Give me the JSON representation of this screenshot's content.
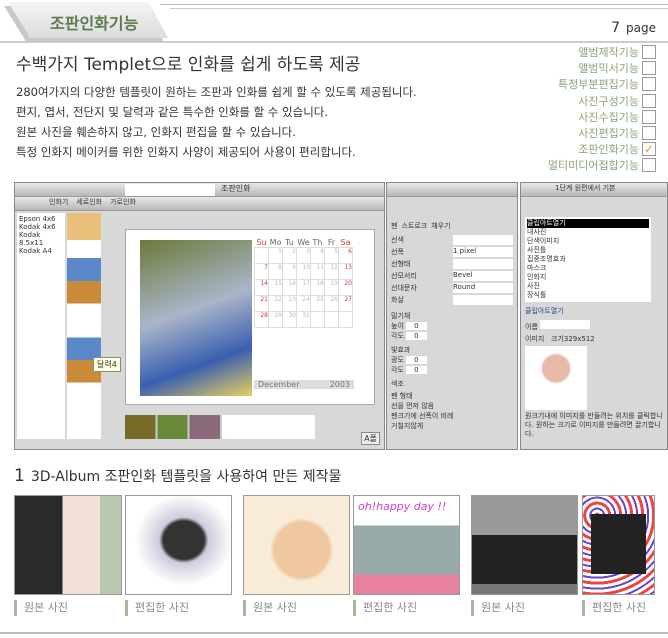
{
  "header": {
    "tab_title": "조판인화기능",
    "page_number": "7",
    "page_label": "page"
  },
  "main": {
    "title": "수백가지 Templet으로 인화를 쉽게 하도록 제공",
    "lines": [
      "280여가지의 다양한 템플릿이 원하는 조판과 인화를 쉽게 할 수 있도록 제공됩니다.",
      "편지, 엽서, 전단지 및 달력과 같은 특수한 인화를 할 수 있습니다.",
      "원본 사진을 훼손하지 않고, 인화지 편집을 할 수 있습니다.",
      "특정 인화지 메이커를 위한 인화지 사양이 제공되어 사용이 편리합니다."
    ]
  },
  "features": [
    {
      "label": "앨범제작기능",
      "checked": false
    },
    {
      "label": "앨범믹서기능",
      "checked": false
    },
    {
      "label": "특정부분편집기능",
      "checked": false
    },
    {
      "label": "사진구성기능",
      "checked": false
    },
    {
      "label": "사진수집기능",
      "checked": false
    },
    {
      "label": "사진편집기능",
      "checked": false
    },
    {
      "label": "조판인화기능",
      "checked": true,
      "mark": "✓"
    },
    {
      "label": "멀티미디어접합기능",
      "checked": false
    }
  ],
  "screenshot": {
    "tab": "조판인화",
    "toolbar": {
      "print": "인화기",
      "option": "세로인화",
      "option2": "가로인화"
    },
    "tree": [
      "Epson 4x6",
      "Kodak 4x6",
      "Kodak 8.5x11",
      "Kodak A4"
    ],
    "tooltip": "달력4",
    "calendar": {
      "days": [
        "Su",
        "Mo",
        "Tu",
        "We",
        "Th",
        "Fr",
        "Sa"
      ],
      "dates": [
        "",
        "1",
        "2",
        "3",
        "4",
        "5",
        "6",
        "7",
        "8",
        "9",
        "10",
        "11",
        "12",
        "13",
        "14",
        "15",
        "16",
        "17",
        "18",
        "19",
        "20",
        "21",
        "22",
        "23",
        "24",
        "25",
        "26",
        "27",
        "28",
        "29",
        "30",
        "31"
      ],
      "month": "December",
      "year": "2003"
    },
    "zoom_btn": "A폴",
    "pen_tabs": [
      "펜",
      "스트로크",
      "채우기"
    ],
    "pen_fields": [
      {
        "label": "선색",
        "value": ""
      },
      {
        "label": "선폭",
        "value": "1 pixel"
      },
      {
        "label": "선형태",
        "value": ""
      },
      {
        "label": "선모서리",
        "value": "Bevel"
      },
      {
        "label": "선대문자",
        "value": "Round"
      },
      {
        "label": "화살",
        "value": ""
      }
    ],
    "emboss": {
      "title": "밀기채",
      "fields": [
        {
          "label": "높이",
          "value": "0"
        },
        {
          "label": "각도",
          "value": "0"
        }
      ]
    },
    "light": {
      "title": "빛효과",
      "fields": [
        {
          "label": "광도",
          "value": "0"
        },
        {
          "label": "각도",
          "value": "0"
        }
      ]
    },
    "texture_label": "색조",
    "pen_shape": {
      "title": "펜 형태",
      "options": [
        "선을 먼저 않음",
        "펜크기에 선폭이 비례",
        "거칠지않게"
      ]
    },
    "step": "1단계",
    "step_text": "원편에서 기본",
    "clipart_list": [
      "클립아트열기",
      "내사진",
      "단색이미지",
      "사진틀",
      "집중조명효과",
      "마스크",
      "인화지",
      "사진",
      "장식틀"
    ],
    "clipart_open": "클립아트열기",
    "name_label": "이름",
    "image_label": "이미지",
    "size_label": "크기329x512",
    "help": "원크기내에 이미지를 만들려는 위치를 클릭합니다. 원하는 크기로 이미지를 만들려면 끌기합니다."
  },
  "section": {
    "number": "1",
    "title": "3D-Album 조판인화 템플릿을 사용하여 만든 제작물",
    "captions": [
      "원본 사진",
      "편집한 사진",
      "원본 사진",
      "편집한 사진",
      "원본 사진",
      "편집한 사진"
    ],
    "overlay_text": "oh!happy day !!"
  },
  "colors": {
    "accent": "#5d7a4f",
    "feature": "#8ba27a",
    "check": "#f39c12"
  }
}
